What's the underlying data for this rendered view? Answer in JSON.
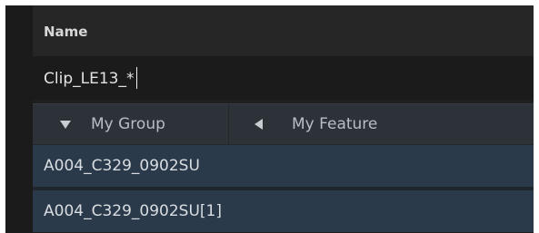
{
  "header": {
    "name_label": "Name"
  },
  "name_field": {
    "value": "Clip_LE13_*"
  },
  "group_bar": {
    "group_label": "My Group",
    "feature_label": "My Feature"
  },
  "rows": [
    {
      "label": "A004_C329_0902SU"
    },
    {
      "label": "A004_C329_0902SU[1]"
    }
  ]
}
